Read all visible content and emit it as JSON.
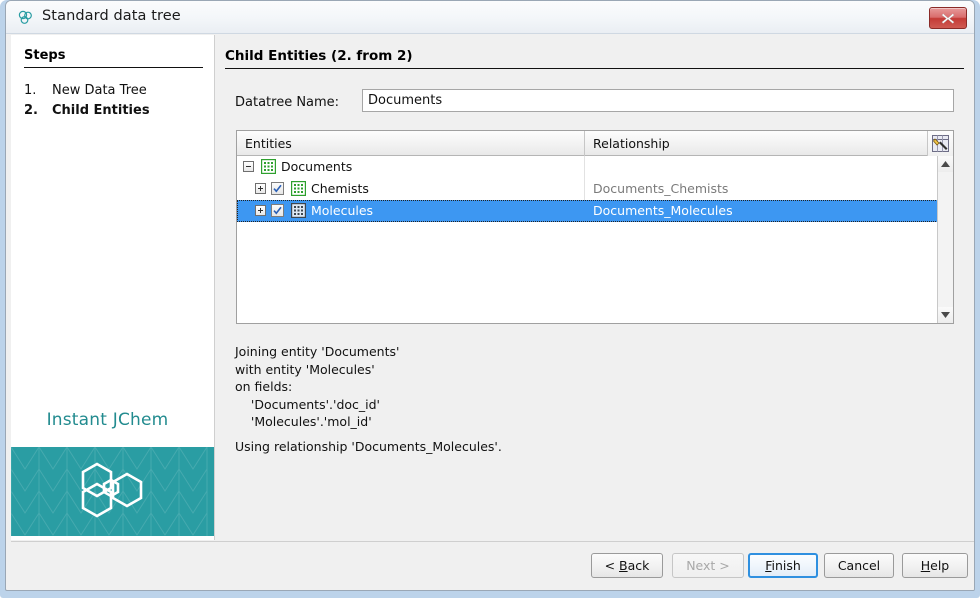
{
  "window": {
    "title": "Standard data tree",
    "icon": "jchem-molecule-icon",
    "close_label": "close-icon"
  },
  "steps": {
    "heading": "Steps",
    "items": [
      {
        "number": "1.",
        "label": "New Data Tree",
        "current": false
      },
      {
        "number": "2.",
        "label": "Child Entities",
        "current": true
      }
    ]
  },
  "brand": {
    "name": "Instant JChem",
    "accent_color": "#2a9da3",
    "text_color": "#228b8f"
  },
  "main": {
    "page_title": "Child Entities (2. from 2)",
    "datatree": {
      "label": "Datatree Name:",
      "value": "Documents",
      "placeholder": ""
    },
    "table": {
      "columns": [
        "Entities",
        "Relationship"
      ],
      "corner_icon": "column-chooser-icon",
      "rows": [
        {
          "name": "Documents",
          "relationship": "",
          "indent": 0,
          "toggle": "minus",
          "has_checkbox": false,
          "checked": false,
          "selected": false,
          "icon": "entity-grid-icon-green"
        },
        {
          "name": "Chemists",
          "relationship": "Documents_Chemists",
          "indent": 1,
          "toggle": "plus",
          "has_checkbox": true,
          "checked": true,
          "selected": false,
          "icon": "entity-grid-icon-green"
        },
        {
          "name": "Molecules",
          "relationship": "Documents_Molecules",
          "indent": 1,
          "toggle": "plus",
          "has_checkbox": true,
          "checked": true,
          "selected": true,
          "icon": "entity-grid-icon-gray"
        }
      ],
      "selection_color": "#3d97f2"
    },
    "description": "Joining entity 'Documents'\nwith entity 'Molecules'\non fields:\n    'Documents'.'doc_id'\n    'Molecules'.'mol_id'",
    "description2": "Using relationship 'Documents_Molecules'."
  },
  "buttons": {
    "back": {
      "label": "< Back",
      "disabled": false,
      "focused": false
    },
    "next": {
      "label": "Next >",
      "disabled": true,
      "focused": false
    },
    "finish": {
      "label": "Finish",
      "disabled": false,
      "focused": true
    },
    "cancel": {
      "label": "Cancel",
      "disabled": false,
      "focused": false
    },
    "help": {
      "label": "Help",
      "disabled": false,
      "focused": false
    }
  }
}
